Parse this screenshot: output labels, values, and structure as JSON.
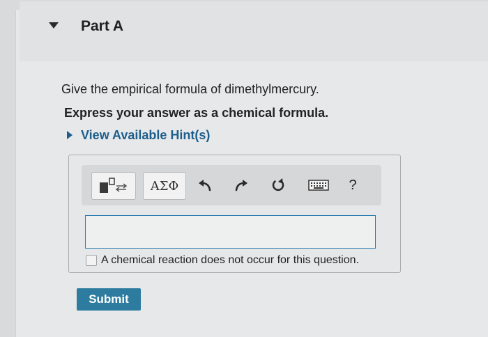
{
  "part": {
    "title": "Part A"
  },
  "question": {
    "prompt": "Give the empirical formula of dimethylmercury.",
    "instruction": "Express your answer as a chemical formula."
  },
  "hints": {
    "label": "View Available Hint(s)"
  },
  "toolbar": {
    "greek_label": "ΑΣΦ",
    "help_label": "?",
    "icons": [
      "template-icon",
      "undo-icon",
      "redo-icon",
      "reset-icon",
      "keyboard-icon"
    ]
  },
  "answer": {
    "value": "",
    "no_reaction_label": "A chemical reaction does not occur for this question.",
    "no_reaction_checked": false
  },
  "submit": {
    "label": "Submit"
  },
  "colors": {
    "link": "#1d5f8c",
    "submit_bg": "#2d7c9f",
    "input_border": "#2c7fb0"
  }
}
